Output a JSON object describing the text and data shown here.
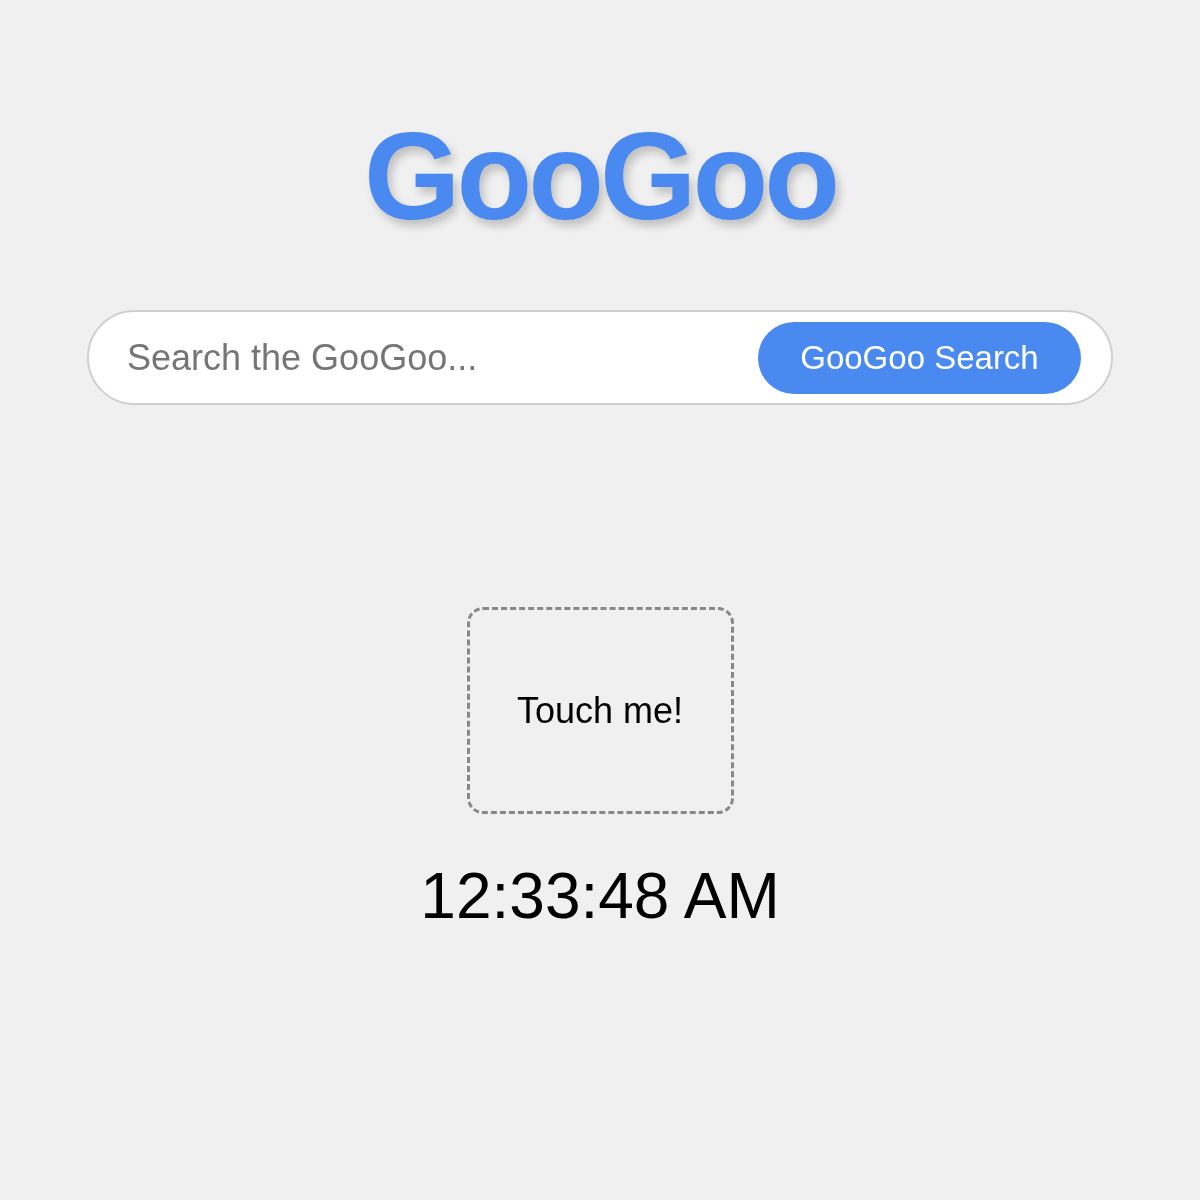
{
  "logo": "GooGoo",
  "search": {
    "placeholder": "Search the GooGoo...",
    "button": "GooGoo Search"
  },
  "touch_area": {
    "label": "Touch me!"
  },
  "clock": "12:33:48 AM"
}
